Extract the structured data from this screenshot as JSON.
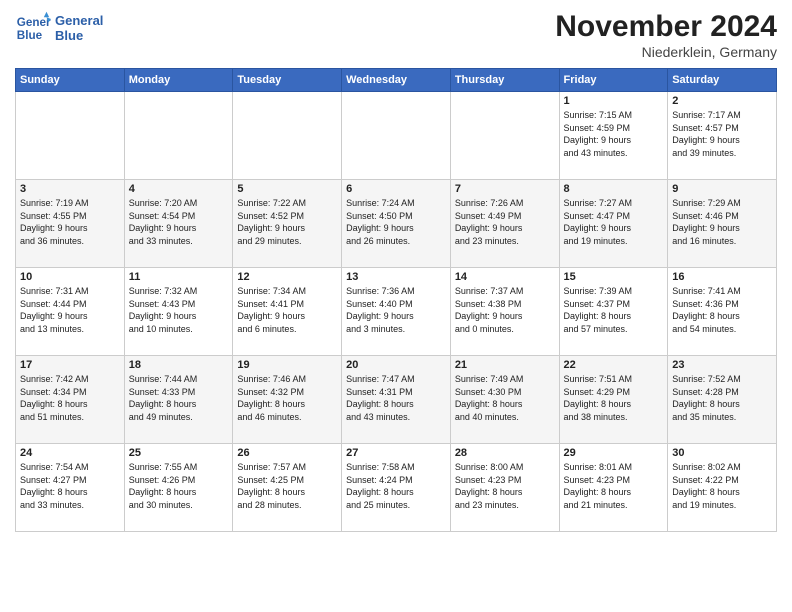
{
  "header": {
    "logo_line1": "General",
    "logo_line2": "Blue",
    "month_title": "November 2024",
    "location": "Niederklein, Germany"
  },
  "weekdays": [
    "Sunday",
    "Monday",
    "Tuesday",
    "Wednesday",
    "Thursday",
    "Friday",
    "Saturday"
  ],
  "weeks": [
    [
      {
        "day": "",
        "info": ""
      },
      {
        "day": "",
        "info": ""
      },
      {
        "day": "",
        "info": ""
      },
      {
        "day": "",
        "info": ""
      },
      {
        "day": "",
        "info": ""
      },
      {
        "day": "1",
        "info": "Sunrise: 7:15 AM\nSunset: 4:59 PM\nDaylight: 9 hours\nand 43 minutes."
      },
      {
        "day": "2",
        "info": "Sunrise: 7:17 AM\nSunset: 4:57 PM\nDaylight: 9 hours\nand 39 minutes."
      }
    ],
    [
      {
        "day": "3",
        "info": "Sunrise: 7:19 AM\nSunset: 4:55 PM\nDaylight: 9 hours\nand 36 minutes."
      },
      {
        "day": "4",
        "info": "Sunrise: 7:20 AM\nSunset: 4:54 PM\nDaylight: 9 hours\nand 33 minutes."
      },
      {
        "day": "5",
        "info": "Sunrise: 7:22 AM\nSunset: 4:52 PM\nDaylight: 9 hours\nand 29 minutes."
      },
      {
        "day": "6",
        "info": "Sunrise: 7:24 AM\nSunset: 4:50 PM\nDaylight: 9 hours\nand 26 minutes."
      },
      {
        "day": "7",
        "info": "Sunrise: 7:26 AM\nSunset: 4:49 PM\nDaylight: 9 hours\nand 23 minutes."
      },
      {
        "day": "8",
        "info": "Sunrise: 7:27 AM\nSunset: 4:47 PM\nDaylight: 9 hours\nand 19 minutes."
      },
      {
        "day": "9",
        "info": "Sunrise: 7:29 AM\nSunset: 4:46 PM\nDaylight: 9 hours\nand 16 minutes."
      }
    ],
    [
      {
        "day": "10",
        "info": "Sunrise: 7:31 AM\nSunset: 4:44 PM\nDaylight: 9 hours\nand 13 minutes."
      },
      {
        "day": "11",
        "info": "Sunrise: 7:32 AM\nSunset: 4:43 PM\nDaylight: 9 hours\nand 10 minutes."
      },
      {
        "day": "12",
        "info": "Sunrise: 7:34 AM\nSunset: 4:41 PM\nDaylight: 9 hours\nand 6 minutes."
      },
      {
        "day": "13",
        "info": "Sunrise: 7:36 AM\nSunset: 4:40 PM\nDaylight: 9 hours\nand 3 minutes."
      },
      {
        "day": "14",
        "info": "Sunrise: 7:37 AM\nSunset: 4:38 PM\nDaylight: 9 hours\nand 0 minutes."
      },
      {
        "day": "15",
        "info": "Sunrise: 7:39 AM\nSunset: 4:37 PM\nDaylight: 8 hours\nand 57 minutes."
      },
      {
        "day": "16",
        "info": "Sunrise: 7:41 AM\nSunset: 4:36 PM\nDaylight: 8 hours\nand 54 minutes."
      }
    ],
    [
      {
        "day": "17",
        "info": "Sunrise: 7:42 AM\nSunset: 4:34 PM\nDaylight: 8 hours\nand 51 minutes."
      },
      {
        "day": "18",
        "info": "Sunrise: 7:44 AM\nSunset: 4:33 PM\nDaylight: 8 hours\nand 49 minutes."
      },
      {
        "day": "19",
        "info": "Sunrise: 7:46 AM\nSunset: 4:32 PM\nDaylight: 8 hours\nand 46 minutes."
      },
      {
        "day": "20",
        "info": "Sunrise: 7:47 AM\nSunset: 4:31 PM\nDaylight: 8 hours\nand 43 minutes."
      },
      {
        "day": "21",
        "info": "Sunrise: 7:49 AM\nSunset: 4:30 PM\nDaylight: 8 hours\nand 40 minutes."
      },
      {
        "day": "22",
        "info": "Sunrise: 7:51 AM\nSunset: 4:29 PM\nDaylight: 8 hours\nand 38 minutes."
      },
      {
        "day": "23",
        "info": "Sunrise: 7:52 AM\nSunset: 4:28 PM\nDaylight: 8 hours\nand 35 minutes."
      }
    ],
    [
      {
        "day": "24",
        "info": "Sunrise: 7:54 AM\nSunset: 4:27 PM\nDaylight: 8 hours\nand 33 minutes."
      },
      {
        "day": "25",
        "info": "Sunrise: 7:55 AM\nSunset: 4:26 PM\nDaylight: 8 hours\nand 30 minutes."
      },
      {
        "day": "26",
        "info": "Sunrise: 7:57 AM\nSunset: 4:25 PM\nDaylight: 8 hours\nand 28 minutes."
      },
      {
        "day": "27",
        "info": "Sunrise: 7:58 AM\nSunset: 4:24 PM\nDaylight: 8 hours\nand 25 minutes."
      },
      {
        "day": "28",
        "info": "Sunrise: 8:00 AM\nSunset: 4:23 PM\nDaylight: 8 hours\nand 23 minutes."
      },
      {
        "day": "29",
        "info": "Sunrise: 8:01 AM\nSunset: 4:23 PM\nDaylight: 8 hours\nand 21 minutes."
      },
      {
        "day": "30",
        "info": "Sunrise: 8:02 AM\nSunset: 4:22 PM\nDaylight: 8 hours\nand 19 minutes."
      }
    ]
  ]
}
